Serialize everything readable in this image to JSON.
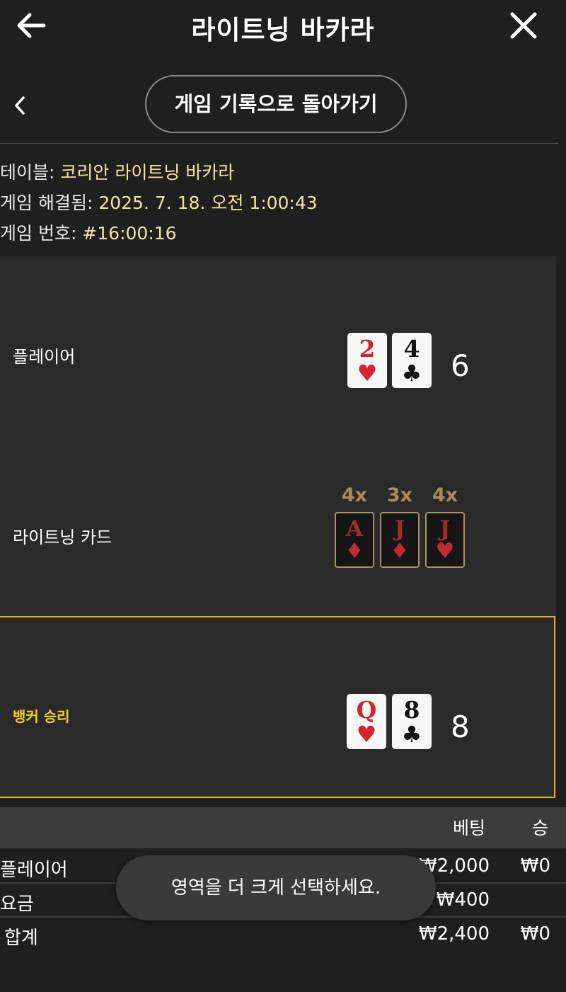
{
  "header": {
    "title": "라이트닝 바카라"
  },
  "nav": {
    "back_history_label": "게임 기록으로 돌아가기"
  },
  "info": {
    "table_label": "테이블:",
    "table_value": "코리안 라이트닝 바카라",
    "resolved_label": "게임 해결됨:",
    "resolved_value": "2025. 7. 18. 오전 1:00:43",
    "game_no_label": "게임 번호:",
    "game_no_value": "#16:00:16"
  },
  "player": {
    "label": "플레이어",
    "cards": [
      {
        "rank": "2",
        "suit": "♥"
      },
      {
        "rank": "4",
        "suit": "♣"
      }
    ],
    "score": "6"
  },
  "lightning": {
    "label": "라이트닝 카드",
    "cards": [
      {
        "rank": "A",
        "suit": "♦",
        "mult": "4x"
      },
      {
        "rank": "J",
        "suit": "♦",
        "mult": "3x"
      },
      {
        "rank": "J",
        "suit": "♥",
        "mult": "4x"
      }
    ]
  },
  "banker": {
    "label": "뱅커 승리",
    "cards": [
      {
        "rank": "Q",
        "suit": "♥"
      },
      {
        "rank": "8",
        "suit": "♣"
      }
    ],
    "score": "8"
  },
  "table": {
    "headers": {
      "bet": "베팅",
      "win": "승"
    },
    "rows": [
      {
        "name": "플레이어",
        "bet": "₩2,000",
        "win": "₩0"
      },
      {
        "name": "요금",
        "bet": "₩400",
        "win": ""
      },
      {
        "name": "합계",
        "bet": "₩2,400",
        "win": "₩0"
      }
    ]
  },
  "toast": {
    "text": "영역을 더 크게 선택하세요."
  },
  "colors": {
    "accent": "#f4d21e",
    "info_value": "#f2e3a4",
    "card_red": "#d6232c"
  }
}
